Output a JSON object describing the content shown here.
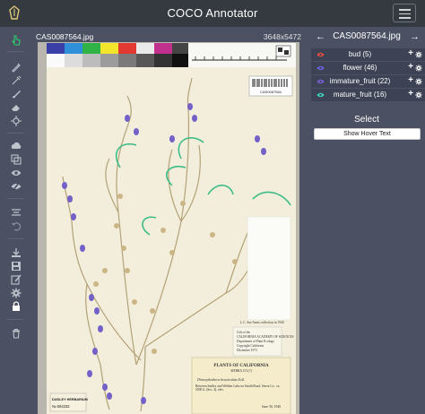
{
  "app": {
    "title": "COCO Annotator"
  },
  "toolbar": {
    "tools": [
      {
        "name": "select-tool-icon",
        "active": true
      },
      {
        "name": "bbox-tool-icon"
      },
      {
        "name": "polygon-tool-icon"
      },
      {
        "name": "brush-tool-icon"
      },
      {
        "name": "eraser-tool-icon"
      },
      {
        "name": "keypoint-tool-icon"
      },
      {
        "name": "upload-annotations-icon"
      },
      {
        "name": "copy-annotations-icon"
      },
      {
        "name": "show-all-icon"
      },
      {
        "name": "hide-all-icon"
      },
      {
        "name": "align-icon"
      },
      {
        "name": "undo-icon"
      },
      {
        "name": "download-icon"
      },
      {
        "name": "save-icon"
      },
      {
        "name": "edit-icon"
      },
      {
        "name": "settings-icon"
      },
      {
        "name": "lock-icon"
      },
      {
        "name": "delete-icon"
      }
    ],
    "active_color": "#2ecc71"
  },
  "image": {
    "filename": "CAS0087564.jpg",
    "dimensions": "3648x5472"
  },
  "panel": {
    "title": "CAS0087564.jpg",
    "prev_arrow": "←",
    "next_arrow": "→",
    "categories": [
      {
        "label": "bud (5)",
        "color": "#e74c3c"
      },
      {
        "label": "flower (46)",
        "color": "#6c63e0"
      },
      {
        "label": "immature_fruit (22)",
        "color": "#7b5fd6"
      },
      {
        "label": "mature_fruit (16)",
        "color": "#3cd6c4"
      }
    ],
    "add_symbol": "+",
    "select_label": "Select",
    "hover_button": "Show Hover Text"
  },
  "specimen": {
    "small_label_lines": [
      "Gift of the",
      "CALIFORNIA ACADEMY OF SCIENCES",
      "Department of Plant Ecology",
      "Copyright California",
      "December 1973"
    ],
    "mid_label": "L.C. Sue Ames collection in 1940",
    "plants_header": "PLANTS OF CALIFORNIA",
    "plants_sub": "SIERRA CO.(?)",
    "species": "Dimorphotheca bracteolata Zoll.",
    "locality": "Between Sattley and Webber Lake on Smith Road, Sierra Co., ca. 5500 ft. (Sec. 4), elev.",
    "date": "June 30, 1940",
    "herbarium": "DUDLEY HERBARIUM",
    "accession": "№ 694332",
    "top_right_label": "CAS0087564"
  }
}
